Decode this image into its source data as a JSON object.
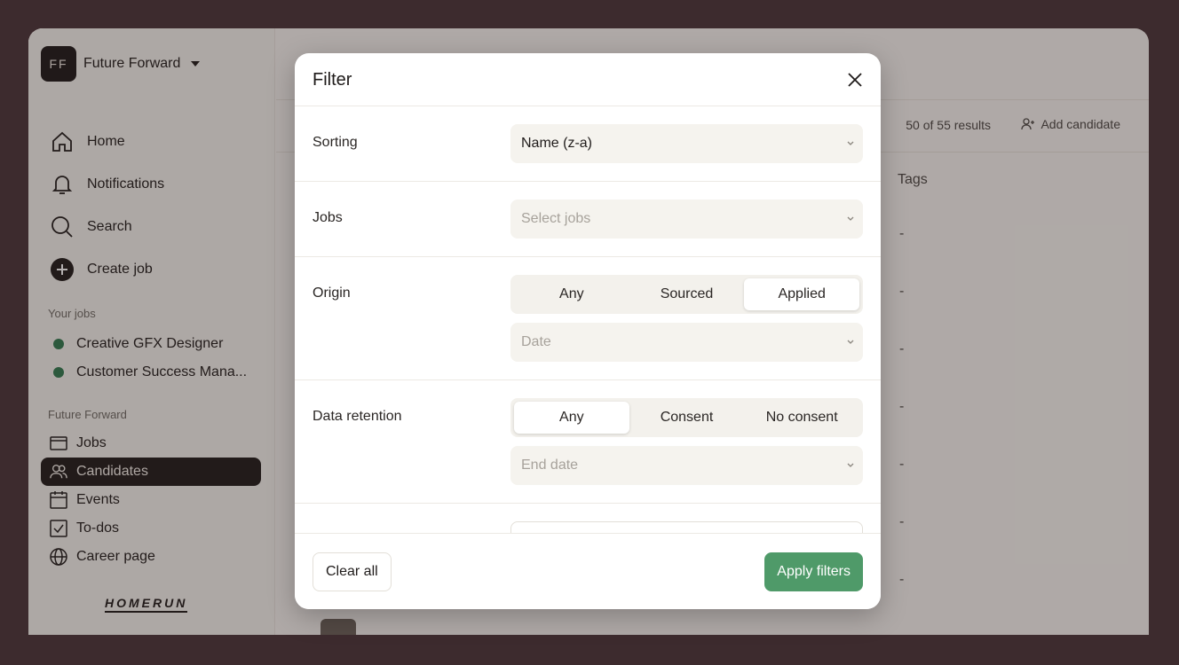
{
  "workspace": {
    "initials": "FF",
    "name": "Future Forward"
  },
  "nav_main": [
    {
      "label": "Home",
      "icon": "home-icon"
    },
    {
      "label": "Notifications",
      "icon": "bell-icon"
    },
    {
      "label": "Search",
      "icon": "search-icon"
    },
    {
      "label": "Create job",
      "icon": "plus-circle-icon"
    }
  ],
  "your_jobs": {
    "label": "Your jobs",
    "items": [
      "Creative GFX Designer",
      "Customer Success Mana..."
    ]
  },
  "org_section": {
    "label": "Future Forward",
    "items": [
      {
        "label": "Jobs",
        "icon": "jobs-icon"
      },
      {
        "label": "Candidates",
        "icon": "users-icon",
        "active": true
      },
      {
        "label": "Events",
        "icon": "calendar-icon"
      },
      {
        "label": "To-dos",
        "icon": "checkbox-icon"
      },
      {
        "label": "Career page",
        "icon": "globe-icon"
      }
    ]
  },
  "logo": "HOMERUN",
  "main": {
    "results": "50 of 55 results",
    "add_candidate": "Add candidate",
    "tags_header": "Tags",
    "dash": "-"
  },
  "modal": {
    "title": "Filter",
    "sorting": {
      "label": "Sorting",
      "value": "Name (z-a)"
    },
    "jobs": {
      "label": "Jobs",
      "placeholder": "Select jobs"
    },
    "origin": {
      "label": "Origin",
      "options": [
        "Any",
        "Sourced",
        "Applied"
      ],
      "selected": "Applied",
      "date_placeholder": "Date"
    },
    "retention": {
      "label": "Data retention",
      "options": [
        "Any",
        "Consent",
        "No consent"
      ],
      "selected": "Any",
      "date_placeholder": "End date"
    },
    "clear_label": "Clear all",
    "apply_label": "Apply filters"
  },
  "colors": {
    "accent_green": "#4f9a69",
    "dark": "#1f1b1a",
    "frame": "#3d2b2e"
  }
}
